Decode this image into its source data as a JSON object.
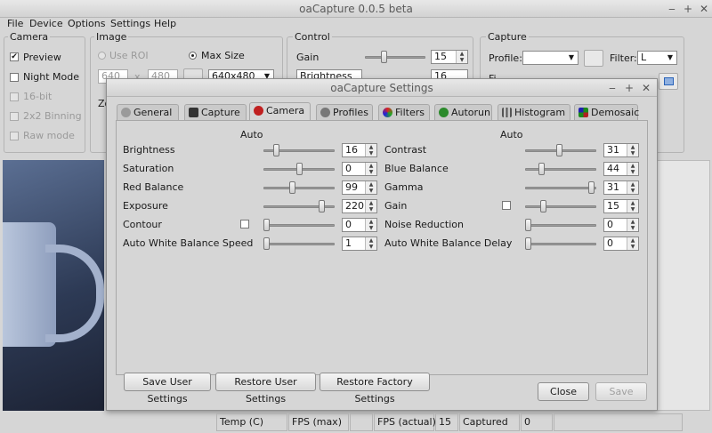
{
  "app": {
    "title": "oaCapture 0.0.5 beta",
    "win_min": "‒",
    "win_max": "+",
    "win_close": "✕"
  },
  "menu": [
    "File",
    "Device",
    "Options",
    "Settings",
    "Help"
  ],
  "camera_group": {
    "title": "Camera",
    "preview": "Preview",
    "night_mode": "Night Mode",
    "bit16": "16-bit",
    "binning": "2x2 Binning",
    "raw_mode": "Raw mode",
    "check": "✔"
  },
  "image_group": {
    "title": "Image",
    "use_roi": "Use ROI",
    "max_size": "Max Size",
    "w": "640",
    "x": "x",
    "h": "480",
    "size": "640x480",
    "zoom": "Zo"
  },
  "control_group": {
    "title": "Control",
    "gain_label": "Gain",
    "gain": "15",
    "control_select": "Brightness",
    "brightness": "16"
  },
  "capture_group": {
    "title": "Capture",
    "profile_label": "Profile:",
    "filter_label": "Filter:",
    "filter": "L",
    "file_partial": "Fi"
  },
  "dialog": {
    "title": "oaCapture Settings",
    "tabs": [
      "General",
      "Capture",
      "Camera",
      "Profiles",
      "Filters",
      "Autorun",
      "Histogram",
      "Demosaic"
    ],
    "auto_label": "Auto",
    "left": [
      {
        "label": "Brightness",
        "value": "16",
        "level": 0.15,
        "auto": false
      },
      {
        "label": "Saturation",
        "value": "0",
        "level": 0.5,
        "auto": false
      },
      {
        "label": "Red Balance",
        "value": "99",
        "level": 0.4,
        "auto": false
      },
      {
        "label": "Exposure",
        "value": "220",
        "level": 0.85,
        "auto": false
      },
      {
        "label": "Contour",
        "value": "0",
        "level": 0.0,
        "auto": true
      },
      {
        "label": "Auto White Balance Speed",
        "value": "1",
        "level": 0.0,
        "auto": false
      }
    ],
    "right": [
      {
        "label": "Contrast",
        "value": "31",
        "level": 0.48,
        "auto": false
      },
      {
        "label": "Blue Balance",
        "value": "44",
        "level": 0.2,
        "auto": false
      },
      {
        "label": "Gamma",
        "value": "31",
        "level": 0.97,
        "auto": false
      },
      {
        "label": "Gain",
        "value": "15",
        "level": 0.23,
        "auto": true
      },
      {
        "label": "Noise Reduction",
        "value": "0",
        "level": 0.0,
        "auto": false
      },
      {
        "label": "Auto White Balance Delay",
        "value": "0",
        "level": 0.0,
        "auto": false
      }
    ],
    "buttons": {
      "save_user": "Save User Settings",
      "restore_user": "Restore User Settings",
      "restore_factory": "Restore Factory Settings",
      "close": "Close",
      "save": "Save"
    }
  },
  "status": {
    "temp": "Temp (C)",
    "fps_max": "FPS (max)",
    "fps_actual": "FPS (actual)",
    "fps_actual_value": "15",
    "captured": "Captured",
    "captured_value": "0"
  },
  "colors": {
    "bg": "#d6d6d6",
    "accent": "#2a63b8"
  }
}
